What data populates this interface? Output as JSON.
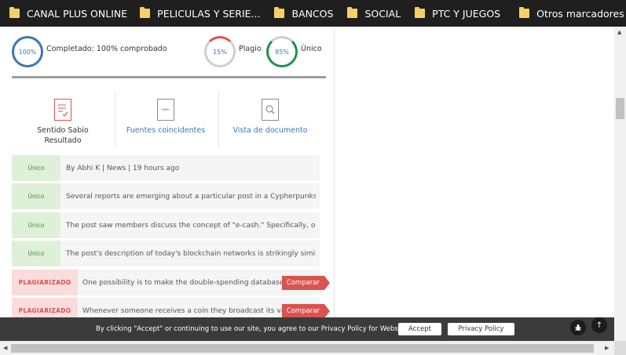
{
  "bookmarks": [
    {
      "label": "CANAL PLUS ONLINE"
    },
    {
      "label": "PELICULAS Y SERIE..."
    },
    {
      "label": "BANCOS"
    },
    {
      "label": "SOCIAL"
    },
    {
      "label": "PTC Y JUEGOS"
    }
  ],
  "other_bookmarks": "Otros marcadores",
  "summary": {
    "completed_value": "100%",
    "completed_label": "Completado: 100% comprobado",
    "plagiarism_value": "15%",
    "plagiarism_label": "Plagio",
    "unique_value": "85%",
    "unique_label": "Único"
  },
  "tools": {
    "result_line1": "Sentido Sabio",
    "result_line2": "Resultado",
    "sources": "Fuentes coincidentes",
    "document": "Vista de documento"
  },
  "rows": [
    {
      "status": "Único",
      "text": "By Abhi K | News | 19 hours ago"
    },
    {
      "status": "Único",
      "text": "Several reports are emerging about a particular post in a Cypherpunks' ..."
    },
    {
      "status": "Único",
      "text": "The post saw members discuss the concept of \"e-cash.\" Specifically, one ..."
    },
    {
      "status": "Único",
      "text": "The post's description of today's blockchain networks is strikingly similar..."
    },
    {
      "status": "PLAGIARIZADO",
      "text": "One possibility is to make the double-spending database p...",
      "action": "Comparar"
    },
    {
      "status": "PLAGIARIZADO",
      "text": "Whenever someone receives a coin they broadcast its value...",
      "action": "Comparar"
    }
  ],
  "cookie": {
    "message": "By clicking \"Accept\" or continuing to use our site, you agree to our Privacy Policy for Website",
    "accept": "Accept",
    "privacy": "Privacy Policy",
    "bug_icon": "bug-icon",
    "up_label": "↑"
  },
  "colors": {
    "unique_ring": "#1f8f4e",
    "plagiarism_ring": "#e05252",
    "completed_ring": "#3a78b4",
    "plagiarized_tag": "#d9534f",
    "unique_tag": "#dff0d8"
  }
}
